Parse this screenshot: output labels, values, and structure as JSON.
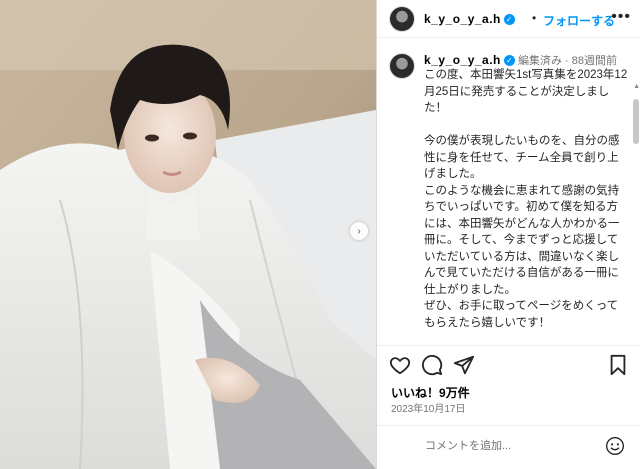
{
  "post": {
    "username": "k_y_o_y_a.h",
    "follow_label": "フォローする",
    "more_label": "•••",
    "verified_mark": "✓",
    "dot_separator": "•",
    "photo_alt": "白いシーツをかぶって座る男性の写真",
    "carousel_next": "›"
  },
  "caption": {
    "username": "k_y_o_y_a.h",
    "meta": "編集済み · 88週間前",
    "text": "この度、本田響矢1st写真集を2023年12月25日に発売することが決定しました！\n\n今の僕が表現したいものを、自分の感性に身を任せて、チーム全員で創り上げました。\nこのような機会に恵まれて感謝の気持ちでいっぱいです。初めて僕を知る方には、本田響矢がどんな人かわかる一冊に。そして、今までずっと応援していただいている方は、間違いなく楽しんで見ていただける自信がある一冊に仕上がりました。\nぜひ、お手に取ってページをめくってもらえたら嬉しいです！\n\n公式Xもできましたので、そちらもぜひチェックを！"
  },
  "actions": {
    "likes": "いいね！9万件",
    "date": "2023年10月17日"
  },
  "comment": {
    "placeholder": "コメントを追加..."
  },
  "icons": [
    "heart-icon",
    "comment-icon",
    "share-icon",
    "bookmark-icon",
    "emoji-icon",
    "more-icon",
    "verified-icon"
  ],
  "colors": {
    "accent": "#0095f6",
    "meta": "#737373",
    "border": "#dbdbdb"
  }
}
